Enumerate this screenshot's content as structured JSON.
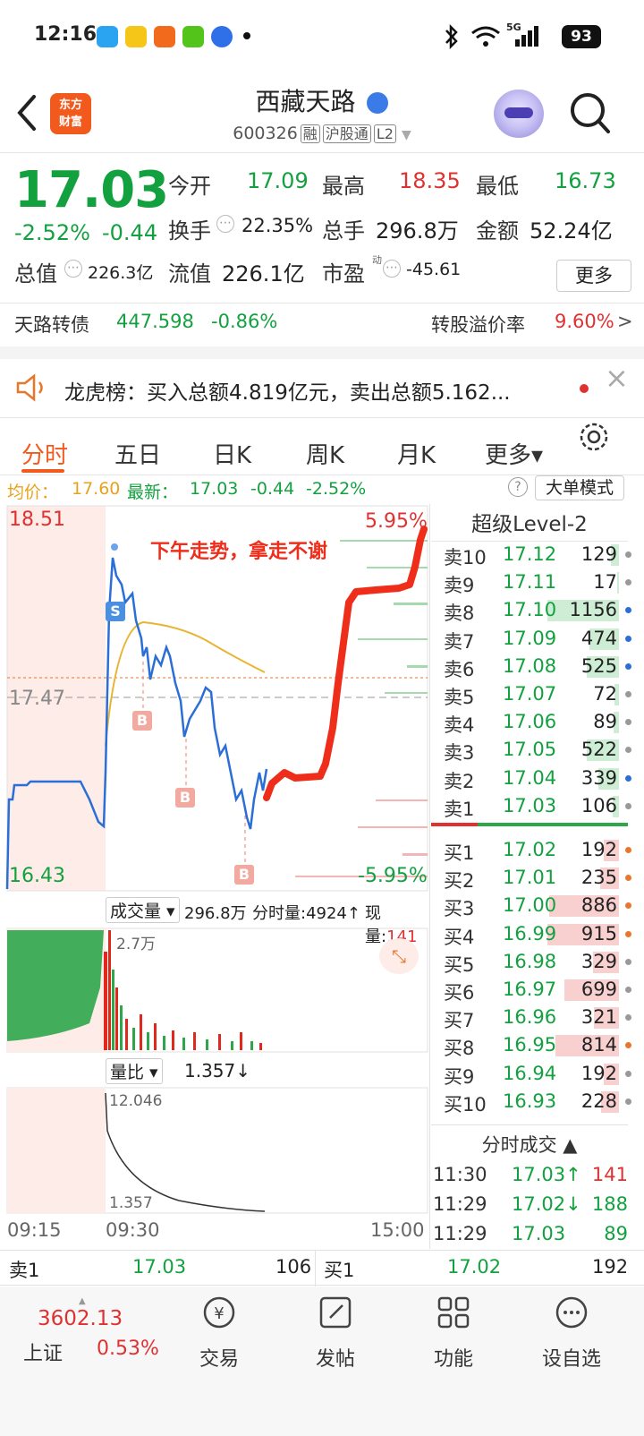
{
  "status_bar": {
    "time": "12:16",
    "battery": "93",
    "network": "5G"
  },
  "header": {
    "title": "西藏天路",
    "code": "600326",
    "tags": [
      "融",
      "沪股通",
      "L2"
    ],
    "logo_line1": "东方",
    "logo_line2": "财富"
  },
  "quote": {
    "price": "17.03",
    "change_pct": "-2.52%",
    "change": "-0.44",
    "open_label": "今开",
    "open": "17.09",
    "high_label": "最高",
    "high": "18.35",
    "low_label": "最低",
    "low": "16.73",
    "turnover_label": "换手",
    "turnover": "22.35%",
    "volume_label": "总手",
    "volume": "296.8万",
    "amount_label": "金额",
    "amount": "52.24亿",
    "mcap_label": "总值",
    "mcap": "226.3亿",
    "float_label": "流值",
    "float_cap": "226.1亿",
    "pe_label": "市盈",
    "pe_sup": "动",
    "pe": "-45.61",
    "more_label": "更多"
  },
  "bond": {
    "name": "天路转债",
    "price": "447.598",
    "change": "-0.86%",
    "premium_label": "转股溢价率",
    "premium": "9.60%",
    "arrow": ">"
  },
  "notice": {
    "text": "龙虎榜：买入总额4.819亿元，卖出总额5.162...",
    "close": "×"
  },
  "tabs": [
    {
      "label": "分时"
    },
    {
      "label": "五日"
    },
    {
      "label": "日K"
    },
    {
      "label": "周K"
    },
    {
      "label": "月K"
    },
    {
      "label": "更多▾"
    }
  ],
  "info_bar": {
    "avg_label": "均价：",
    "avg": "17.60",
    "latest_label": "最新：",
    "latest": "17.03",
    "chg": "-0.44",
    "pct": "-2.52%",
    "big_order": "大单模式",
    "help": "?"
  },
  "chart": {
    "y_top": "18.51",
    "y_mid": "17.47",
    "y_bottom": "16.43",
    "pct_top": "5.95%",
    "pct_bottom": "-5.95%",
    "annotation": "下午走势，拿走不谢",
    "marker_s": "S",
    "marker_b": "B",
    "vol_label": "成交量",
    "vol_total": "296.8万",
    "vol_tick": "分时量:4924↑",
    "vol_now": "现量:141",
    "vol_max": "2.7万",
    "ratio_label": "量比",
    "ratio": "1.357↓",
    "ratio_top": "12.046",
    "ratio_bottom": "1.357",
    "time_start": "09:15",
    "time_open": "09:30",
    "time_end": "15:00"
  },
  "orderbook": {
    "title": "超级Level-2",
    "asks": [
      {
        "label": "卖10",
        "price": "17.12",
        "vol": "129",
        "ratio": 0.11,
        "dot": "#999"
      },
      {
        "label": "卖9",
        "price": "17.11",
        "vol": "17",
        "ratio": 0.02,
        "dot": "#999"
      },
      {
        "label": "卖8",
        "price": "17.10",
        "vol": "1156",
        "ratio": 1.0,
        "dot": "#2b6fd6"
      },
      {
        "label": "卖7",
        "price": "17.09",
        "vol": "474",
        "ratio": 0.41,
        "dot": "#2b6fd6"
      },
      {
        "label": "卖6",
        "price": "17.08",
        "vol": "525",
        "ratio": 0.45,
        "dot": "#2b6fd6"
      },
      {
        "label": "卖5",
        "price": "17.07",
        "vol": "72",
        "ratio": 0.06,
        "dot": "#999"
      },
      {
        "label": "卖4",
        "price": "17.06",
        "vol": "89",
        "ratio": 0.08,
        "dot": "#999"
      },
      {
        "label": "卖3",
        "price": "17.05",
        "vol": "522",
        "ratio": 0.45,
        "dot": "#999"
      },
      {
        "label": "卖2",
        "price": "17.04",
        "vol": "339",
        "ratio": 0.29,
        "dot": "#2b6fd6"
      },
      {
        "label": "卖1",
        "price": "17.03",
        "vol": "106",
        "ratio": 0.09,
        "dot": "#999"
      }
    ],
    "bids": [
      {
        "label": "买1",
        "price": "17.02",
        "vol": "192",
        "ratio": 0.21,
        "dot": "#e8762d"
      },
      {
        "label": "买2",
        "price": "17.01",
        "vol": "235",
        "ratio": 0.26,
        "dot": "#e8762d"
      },
      {
        "label": "买3",
        "price": "17.00",
        "vol": "886",
        "ratio": 0.97,
        "dot": "#e8762d"
      },
      {
        "label": "买4",
        "price": "16.99",
        "vol": "915",
        "ratio": 1.0,
        "dot": "#e8762d"
      },
      {
        "label": "买5",
        "price": "16.98",
        "vol": "329",
        "ratio": 0.36,
        "dot": "#999"
      },
      {
        "label": "买6",
        "price": "16.97",
        "vol": "699",
        "ratio": 0.76,
        "dot": "#999"
      },
      {
        "label": "买7",
        "price": "16.96",
        "vol": "321",
        "ratio": 0.35,
        "dot": "#999"
      },
      {
        "label": "买8",
        "price": "16.95",
        "vol": "814",
        "ratio": 0.89,
        "dot": "#e8762d"
      },
      {
        "label": "买9",
        "price": "16.94",
        "vol": "192",
        "ratio": 0.21,
        "dot": "#999"
      },
      {
        "label": "买10",
        "price": "16.93",
        "vol": "228",
        "ratio": 0.25,
        "dot": "#999"
      }
    ],
    "ticks_title": "分时成交",
    "ticks": [
      {
        "time": "11:30",
        "price": "17.03↑",
        "vol": "141"
      },
      {
        "time": "11:29",
        "price": "17.02↓",
        "vol": "188"
      },
      {
        "time": "11:29",
        "price": "17.03",
        "vol": "89"
      }
    ]
  },
  "bottom_quote": {
    "ask_label": "卖1",
    "ask_price": "17.03",
    "ask_vol": "106",
    "bid_label": "买1",
    "bid_price": "17.02",
    "bid_vol": "192"
  },
  "bottom_nav": {
    "index_value": "3602.13",
    "index_name": "上证",
    "index_pct": "0.53%",
    "items": [
      {
        "label": "交易"
      },
      {
        "label": "发帖"
      },
      {
        "label": "功能"
      },
      {
        "label": "设自选"
      }
    ]
  }
}
